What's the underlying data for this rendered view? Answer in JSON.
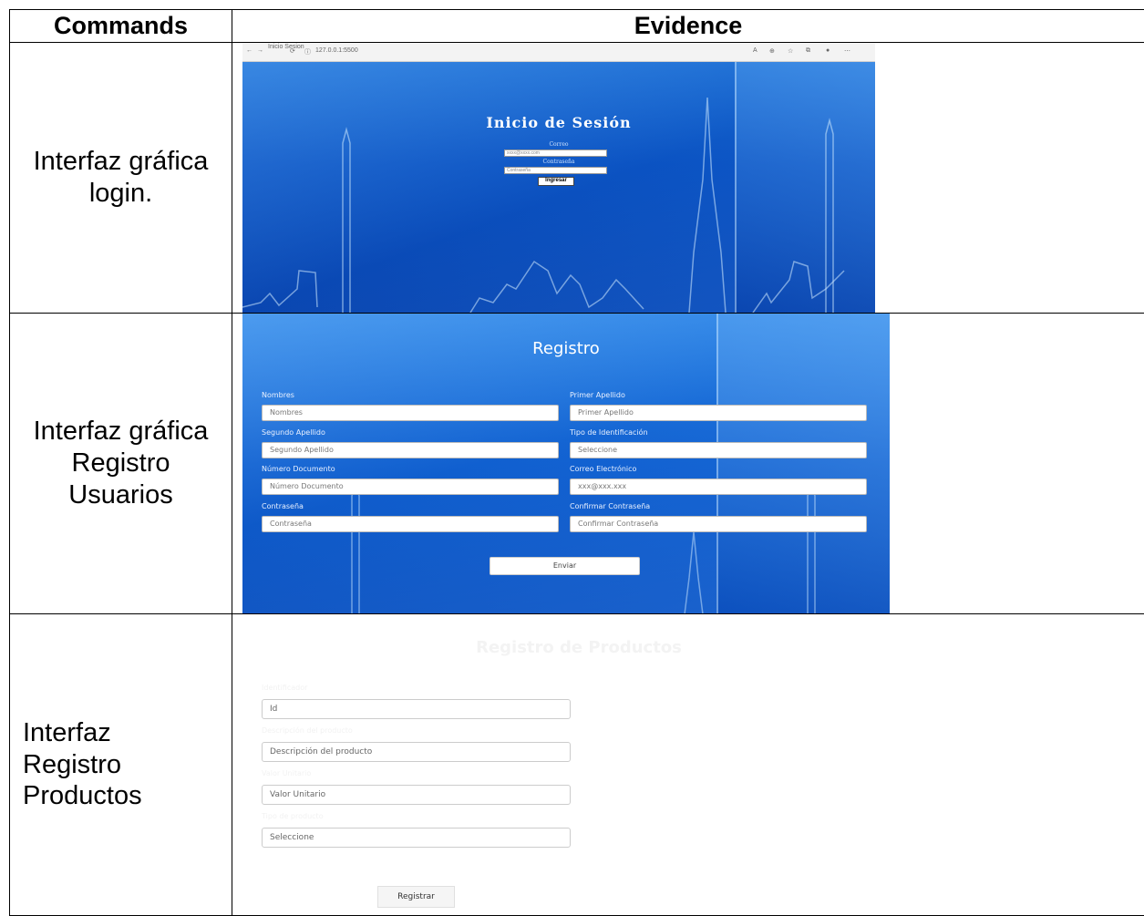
{
  "table": {
    "header_commands": "Commands",
    "header_evidence": "Evidence"
  },
  "rows": [
    {
      "command": "Interfaz gráfica login.",
      "login": {
        "tab_title": "Inicio Sesion",
        "url": "127.0.0.1:5500",
        "title": "Inicio de Sesión",
        "correo_label": "Correo",
        "correo_placeholder": "xxxx@xxxx.com",
        "contrasena_label": "Contraseña",
        "contrasena_placeholder": "Contraseña",
        "button": "Ingresar"
      }
    },
    {
      "command": "Interfaz gráfica Registro Usuarios",
      "registro": {
        "title": "Registro",
        "fields": [
          {
            "label": "Nombres",
            "placeholder": "Nombres"
          },
          {
            "label": "Primer Apellido",
            "placeholder": "Primer Apellido"
          },
          {
            "label": "Segundo Apellido",
            "placeholder": "Segundo Apellido"
          },
          {
            "label": "Tipo de Identificación",
            "placeholder": "Seleccione"
          },
          {
            "label": "Número Documento",
            "placeholder": "Número Documento"
          },
          {
            "label": "Correo Electrónico",
            "placeholder": "xxx@xxx.xxx"
          },
          {
            "label": "Contraseña",
            "placeholder": "Contraseña"
          },
          {
            "label": "Confirmar Contraseña",
            "placeholder": "Confirmar Contraseña"
          }
        ],
        "button": "Enviar"
      }
    },
    {
      "command": "Interfaz Registro Productos",
      "productos": {
        "title": "Registro de Productos",
        "fields": [
          {
            "label": "Identificador",
            "placeholder": "Id"
          },
          {
            "label": "Descripción del producto",
            "placeholder": "Descripción del producto"
          },
          {
            "label": "Valor Unitario",
            "placeholder": "Valor Unitario"
          },
          {
            "label": "Tipo de producto",
            "placeholder": "Seleccione"
          }
        ],
        "button": "Registrar"
      }
    }
  ]
}
